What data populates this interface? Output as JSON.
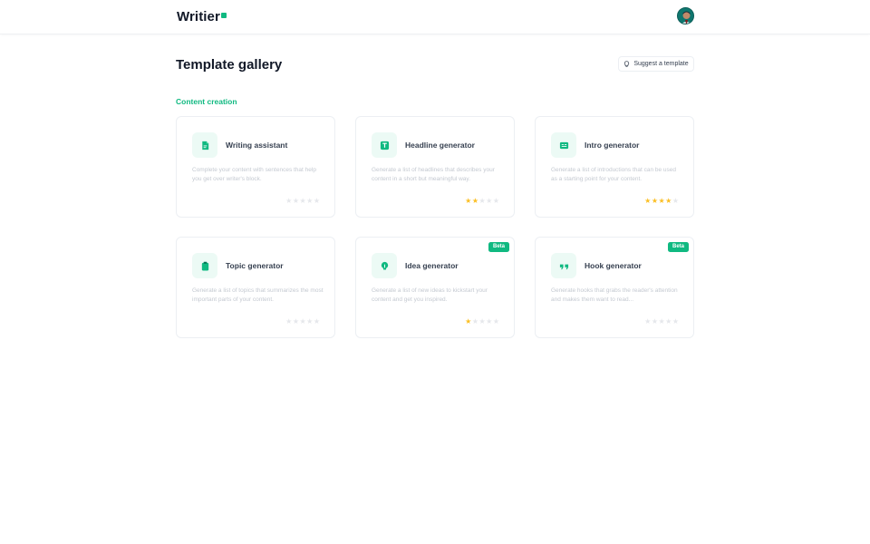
{
  "app": {
    "name": "Writier"
  },
  "page": {
    "title": "Template gallery"
  },
  "actions": {
    "suggest_label": "Suggest a template"
  },
  "section": {
    "title": "Content creation"
  },
  "colors": {
    "accent": "#10b981",
    "star_on": "#fbbf24",
    "star_off": "#e5e7eb"
  },
  "cards": [
    {
      "title": "Writing assistant",
      "description": "Complete your content with sentences that help you get over writer's block.",
      "rating": 0,
      "beta": false,
      "icon": "document-icon"
    },
    {
      "title": "Headline generator",
      "description": "Generate a list of headlines that describes your content in a short but meaningful way.",
      "rating": 2,
      "beta": false,
      "icon": "text-heading-icon"
    },
    {
      "title": "Intro generator",
      "description": "Generate a list of introductions that can be used as a starting point for your content.",
      "rating": 4,
      "beta": false,
      "icon": "text-box-icon"
    },
    {
      "title": "Topic generator",
      "description": "Generate a list of topics that summarizes the most important parts of your content.",
      "rating": 0,
      "beta": false,
      "icon": "clipboard-icon"
    },
    {
      "title": "Idea generator",
      "description": "Generate a list of new ideas to kickstart your content and get you inspired.",
      "rating": 1,
      "beta": true,
      "beta_label": "Beta",
      "icon": "lightbulb-icon"
    },
    {
      "title": "Hook generator",
      "description": "Generate hooks that grabs the reader's attention and makes them want to read...",
      "rating": 0,
      "beta": true,
      "beta_label": "Beta",
      "icon": "quote-icon"
    }
  ]
}
